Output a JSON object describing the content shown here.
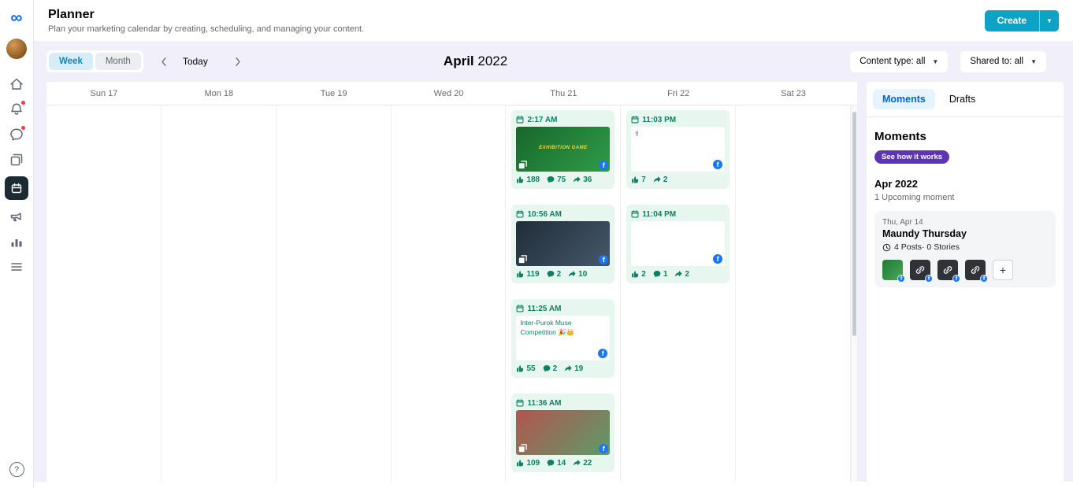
{
  "app": {
    "title": "Planner",
    "subtitle": "Plan your marketing calendar by creating, scheduling, and managing your content.",
    "create_button": "Create"
  },
  "colors": {
    "brand": "#0ca3c6",
    "page_bg": "#f0effa",
    "scheduled_bg": "#e7f6ee",
    "scheduled_accent": "#0e7f63",
    "facebook": "#1877f2",
    "badge_purple": "#5e35b1",
    "tab_blue": "#0064d1"
  },
  "sidebar": {
    "icons": [
      "meta-logo",
      "profile-avatar",
      "home",
      "notifications",
      "messages",
      "posts",
      "planner",
      "ads",
      "insights",
      "more-menu",
      "help"
    ],
    "selected": "planner"
  },
  "toolbar": {
    "view_week": "Week",
    "view_month": "Month",
    "today": "Today",
    "month": "April",
    "year": "2022",
    "content_type_filter": "Content type: all",
    "shared_to_filter": "Shared to: all"
  },
  "calendar": {
    "days": [
      "Sun 17",
      "Mon 18",
      "Tue 19",
      "Wed 20",
      "Thu 21",
      "Fri 22",
      "Sat 23"
    ],
    "posts": [
      {
        "day": 4,
        "time": "2:17 AM",
        "type": "image",
        "media": {
          "colors": [
            "#17672a",
            "#2f9c49"
          ],
          "label": "EXHIBITION GAME"
        },
        "stats": {
          "likes": 188,
          "comments": 75,
          "shares": 36
        }
      },
      {
        "day": 4,
        "time": "10:56 AM",
        "type": "image",
        "media": {
          "colors": [
            "#202d39",
            "#46586b"
          ],
          "label": ""
        },
        "stats": {
          "likes": 119,
          "comments": 2,
          "shares": 10
        }
      },
      {
        "day": 4,
        "time": "11:25 AM",
        "type": "text",
        "text": "Inter-Purok Muse Competition 🎉👑",
        "stats": {
          "likes": 55,
          "comments": 2,
          "shares": 19
        }
      },
      {
        "day": 4,
        "time": "11:36 AM",
        "type": "image",
        "media": {
          "colors": [
            "#b2554f",
            "#5d9b68"
          ],
          "label": ""
        },
        "stats": {
          "likes": 109,
          "comments": 14,
          "shares": 22
        }
      },
      {
        "day": 5,
        "time": "11:03 PM",
        "type": "text",
        "text": "‼",
        "stats": {
          "likes": 7,
          "comments": null,
          "shares": 2
        }
      },
      {
        "day": 5,
        "time": "11:04 PM",
        "type": "text",
        "text": "",
        "stats": {
          "likes": 2,
          "comments": 1,
          "shares": 2
        }
      }
    ]
  },
  "right_panel": {
    "tabs": [
      {
        "label": "Moments"
      },
      {
        "label": "Drafts"
      }
    ],
    "heading": "Moments",
    "badge": "See how it works",
    "month_heading": "Apr 2022",
    "upcoming_text": "1 Upcoming moment",
    "moment": {
      "date": "Thu, Apr 14",
      "title": "Maundy Thursday",
      "meta": "4 Posts· 0 Stories",
      "thumbnails": [
        {
          "type": "image"
        },
        {
          "type": "link"
        },
        {
          "type": "link"
        },
        {
          "type": "link"
        }
      ]
    }
  }
}
